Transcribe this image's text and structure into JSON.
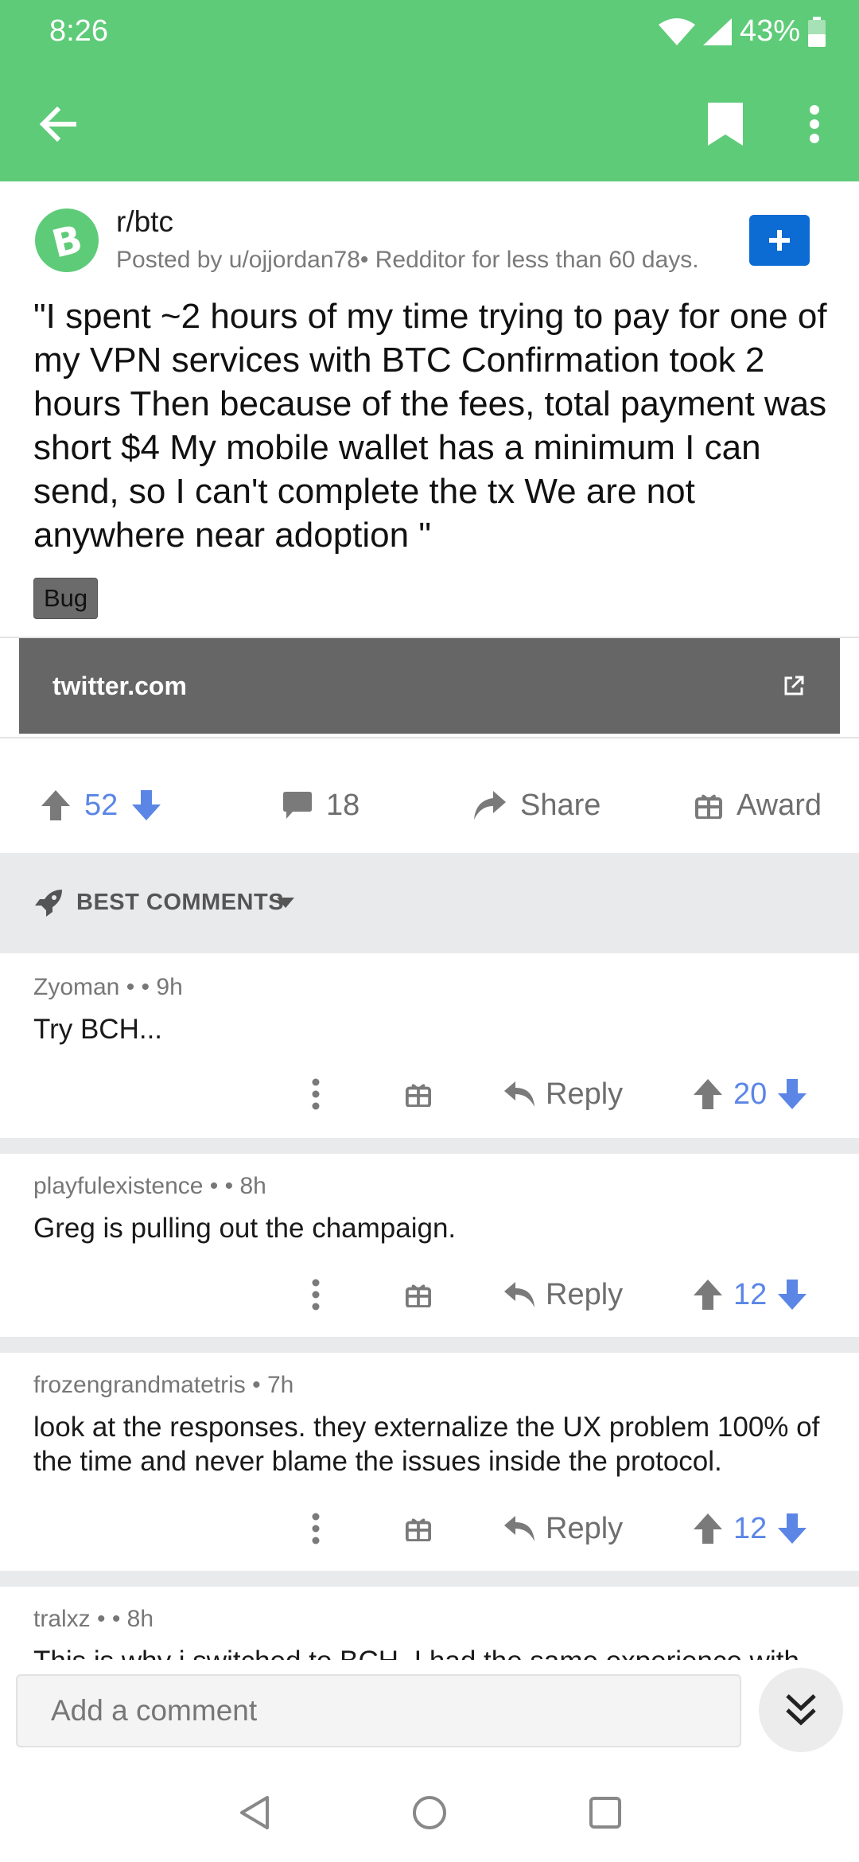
{
  "status": {
    "time": "8:26",
    "battery": "43%"
  },
  "post": {
    "subreddit": "r/btc",
    "meta": "Posted by u/ojjordan78• Redditor for less than 60 days.",
    "title": "\"I spent ~2 hours of my time trying to pay for one of my VPN services with BTC Confirmation took 2 hours Then because of the fees, total payment was short $4 My mobile wallet has a minimum I can send, so I can't complete the tx We are not anywhere near adoption \"",
    "flair": "Bug",
    "link": "twitter.com",
    "score": "52",
    "comments": "18",
    "share_label": "Share",
    "award_label": "Award"
  },
  "sort": {
    "label": "BEST COMMENTS"
  },
  "comments": [
    {
      "author": "Zyoman •  • 9h",
      "body": "Try BCH...",
      "reply": "Reply",
      "score": "20"
    },
    {
      "author": "playfulexistence •  • 8h",
      "body": "Greg is pulling out the champaign.",
      "reply": "Reply",
      "score": "12"
    },
    {
      "author": "frozengrandmatetris • 7h",
      "body": "look at the responses. they externalize the UX  problem 100% of the time and never blame the issues inside the protocol.",
      "reply": "Reply",
      "score": "12"
    },
    {
      "author": "tralxz •  • 8h",
      "body": "This is why i switched to BCH. I had the same experience with"
    }
  ],
  "composer": {
    "placeholder": "Add a comment"
  },
  "colors": {
    "appbar": "#5ecb78",
    "vote_blue": "#5b86e6",
    "join_blue": "#0d6bd4"
  },
  "icons": [
    "back-arrow-icon",
    "bookmark-icon",
    "more-vert-icon",
    "bitcoin-cash-icon",
    "plus-icon",
    "external-link-icon",
    "upvote-icon",
    "downvote-icon",
    "comment-icon",
    "share-icon",
    "award-icon",
    "rocket-icon",
    "caret-down-icon",
    "reply-icon",
    "chevron-double-down-icon"
  ]
}
